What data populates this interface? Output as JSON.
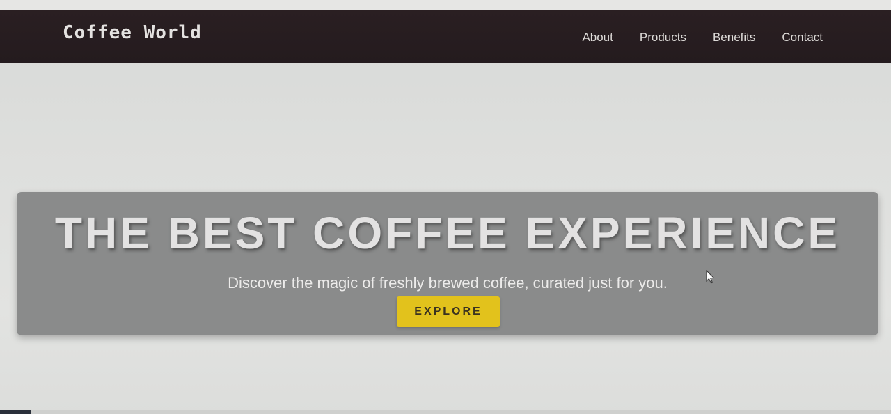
{
  "brand": {
    "name": "Coffee World"
  },
  "nav": {
    "items": [
      {
        "label": "About"
      },
      {
        "label": "Products"
      },
      {
        "label": "Benefits"
      },
      {
        "label": "Contact"
      }
    ]
  },
  "hero": {
    "title": "THE BEST COFFEE EXPERIENCE",
    "subtitle": "Discover the magic of freshly brewed coffee, curated just for you.",
    "cta_label": "EXPLORE"
  },
  "colors": {
    "navbar_bg": "#261c1f",
    "hero_band_bg": "#8a8b8b",
    "cta_bg": "#e2c21c",
    "page_bg": "#dedfdd"
  }
}
